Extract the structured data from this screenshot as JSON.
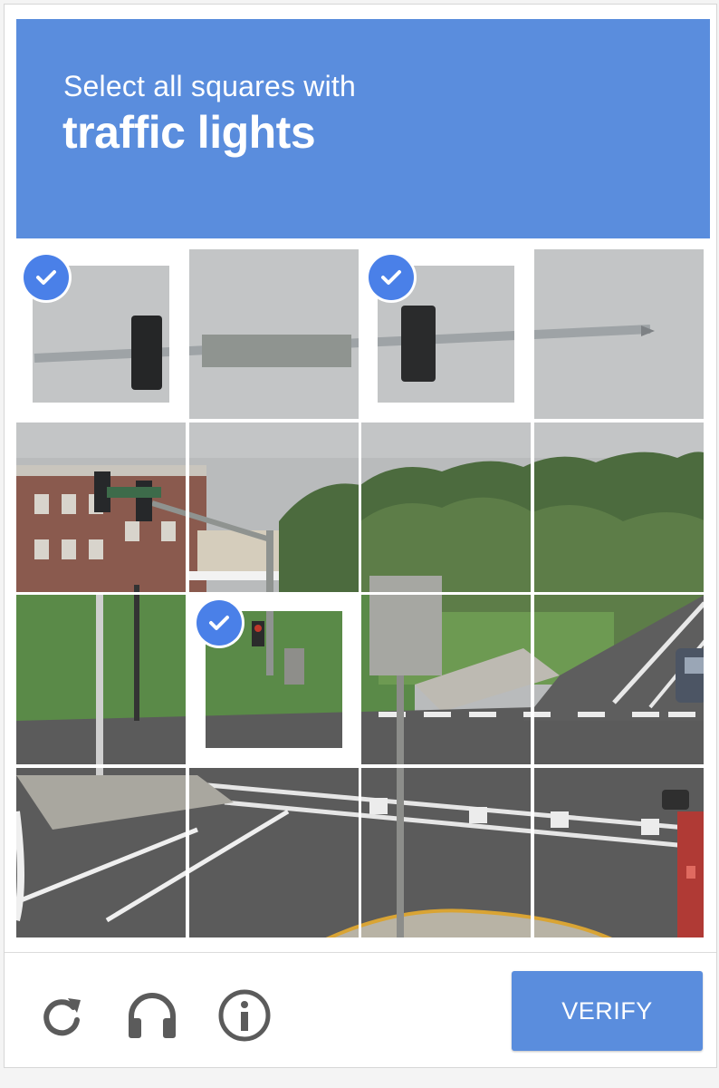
{
  "prompt": {
    "instruction": "Select all squares with",
    "target": "traffic lights"
  },
  "colors": {
    "header_bg": "#5a8ddd",
    "check_bg": "#4a80e8",
    "button_bg": "#5a8ddd"
  },
  "grid": {
    "rows": 4,
    "columns": 4,
    "selected_tiles": [
      {
        "row": 1,
        "col": 1
      },
      {
        "row": 1,
        "col": 3
      },
      {
        "row": 3,
        "col": 2
      }
    ]
  },
  "footer": {
    "reload_icon": "reload-icon",
    "audio_icon": "headphones-icon",
    "info_icon": "info-icon",
    "verify_label": "VERIFY"
  }
}
